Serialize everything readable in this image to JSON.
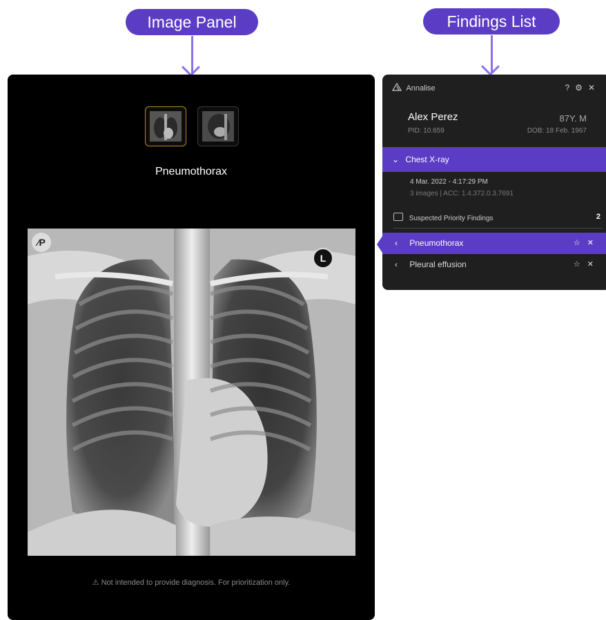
{
  "callouts": {
    "image_panel": "Image Panel",
    "findings_list": "Findings List"
  },
  "image_panel": {
    "active_finding": "Pneumothorax",
    "thumbnails": [
      {
        "name": "frontal-chest-xray",
        "active": true
      },
      {
        "name": "lateral-chest-xray",
        "active": false
      }
    ],
    "badge_text": "⁄P",
    "side_marker": "L",
    "disclaimer": "Not intended to provide diagnosis. For prioritization only."
  },
  "findings_panel": {
    "app_name": "Annalise",
    "header_icons": [
      "help-icon",
      "settings-icon",
      "close-icon"
    ],
    "patient": {
      "name": "Alex Perez",
      "age_sex": "87Y. M",
      "pid": "PID: 10.659",
      "dob": "DOB: 18 Feb. 1967"
    },
    "study": {
      "label": "Chest X-ray",
      "datetime": "4 Mar. 2022 - 4:17:29 PM",
      "meta": "3 images | ACC: 1.4.372.0.3.7691"
    },
    "priority": {
      "label": "Suspected Priority Findings",
      "count": "2"
    },
    "findings": [
      {
        "label": "Pneumothorax",
        "active": true
      },
      {
        "label": "Pleural effusion",
        "active": false
      }
    ]
  },
  "colors": {
    "accent": "#5b3cc4",
    "arrow": "#8b6fe8",
    "panel_bg": "#1f1f1f",
    "image_bg": "#000000"
  }
}
